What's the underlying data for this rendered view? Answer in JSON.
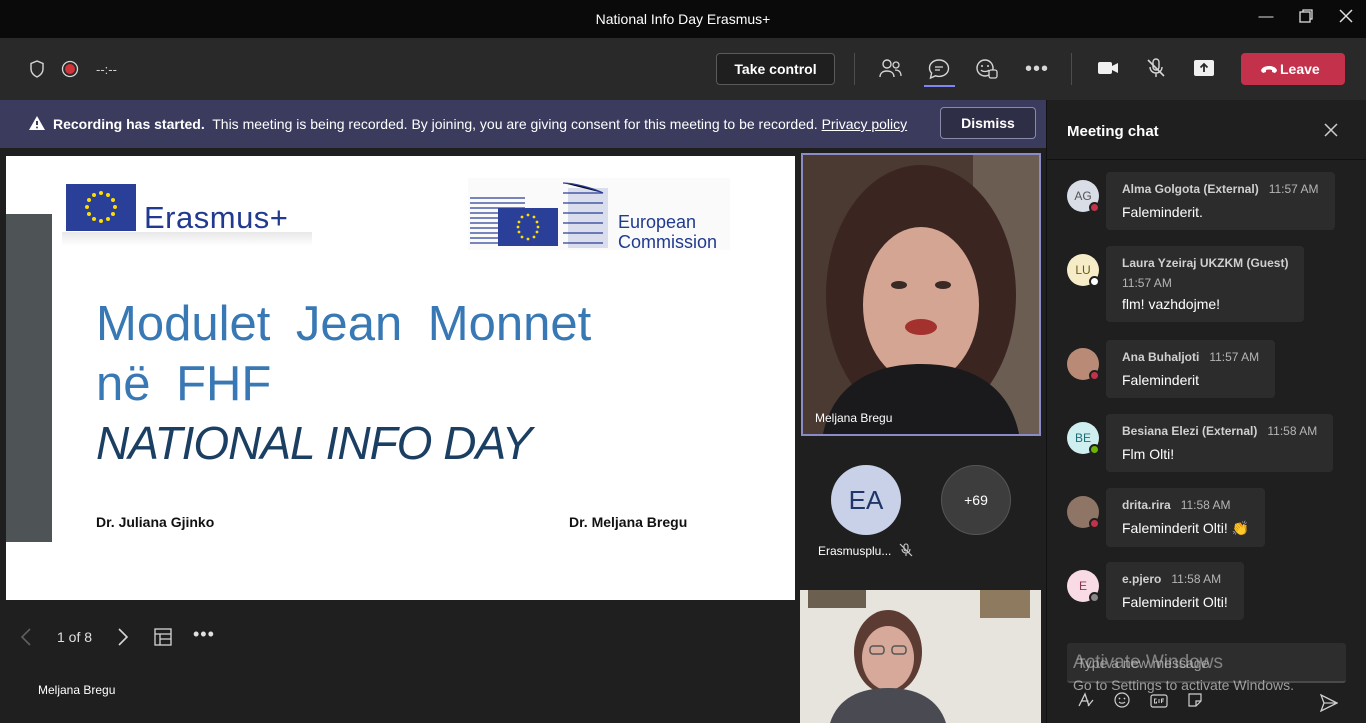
{
  "window": {
    "title": "National Info Day Erasmus+"
  },
  "toolbar": {
    "timer": "--:--",
    "take_control_label": "Take control",
    "leave_label": "Leave"
  },
  "banner": {
    "title": "Recording has started.",
    "message": "This meeting is being recorded. By joining, you are giving consent for this meeting to be recorded.",
    "link": "Privacy policy",
    "dismiss_label": "Dismiss"
  },
  "slide": {
    "logo_left": "Erasmus+",
    "logo_right_line1": "European",
    "logo_right_line2": "Commission",
    "title_line1": "Modulet Jean Monnet",
    "title_line2": "në FHF",
    "title_line3": "NATIONAL INFO DAY",
    "author_left": "Dr. Juliana Gjinko",
    "author_right": "Dr. Meljana Bregu",
    "page_indicator": "1 of 8"
  },
  "stage": {
    "presenter_name": "Meljana Bregu"
  },
  "participants": {
    "video1_name": "Meljana Bregu",
    "avatar_initials": "EA",
    "avatar_name": "Erasmusplu...",
    "more_count": "+69"
  },
  "chat": {
    "title": "Meeting chat",
    "messages": [
      {
        "initials": "AG",
        "name": "Alma Golgota (External)",
        "time": "11:57 AM",
        "text": "Faleminderit.",
        "avatar_bg": "#d9dde6",
        "avatar_fg": "#555",
        "status": "#c4314b"
      },
      {
        "initials": "LU",
        "name": "Laura Yzeiraj UKZKM (Guest)",
        "time": "11:57 AM",
        "text": "flm! vazhdojme!",
        "avatar_bg": "#f6edc8",
        "avatar_fg": "#6b5a14",
        "status": "#ffffff"
      },
      {
        "initials": "",
        "name": "Ana Buhaljoti",
        "time": "11:57 AM",
        "text": "Faleminderit",
        "avatar_bg": "#b98b77",
        "avatar_fg": "#fff",
        "status": "#c4314b"
      },
      {
        "initials": "BE",
        "name": "Besiana Elezi (External)",
        "time": "11:58 AM",
        "text": "Flm Olti!",
        "avatar_bg": "#cfeef0",
        "avatar_fg": "#1d6d75",
        "status": "#6bb700"
      },
      {
        "initials": "",
        "name": "drita.rira",
        "time": "11:58 AM",
        "text": "Faleminderit Olti! 👏",
        "avatar_bg": "#8e7565",
        "avatar_fg": "#fff",
        "status": "#c4314b"
      },
      {
        "initials": "E",
        "name": "e.pjero",
        "time": "11:58 AM",
        "text": "Faleminderit Olti!",
        "avatar_bg": "#f8dbe4",
        "avatar_fg": "#8a3350",
        "status": "#8a8886"
      }
    ],
    "compose_placeholder": "Type a new message",
    "watermark_line1": "Activate Windows",
    "watermark_line2": "Go to Settings to activate Windows."
  }
}
